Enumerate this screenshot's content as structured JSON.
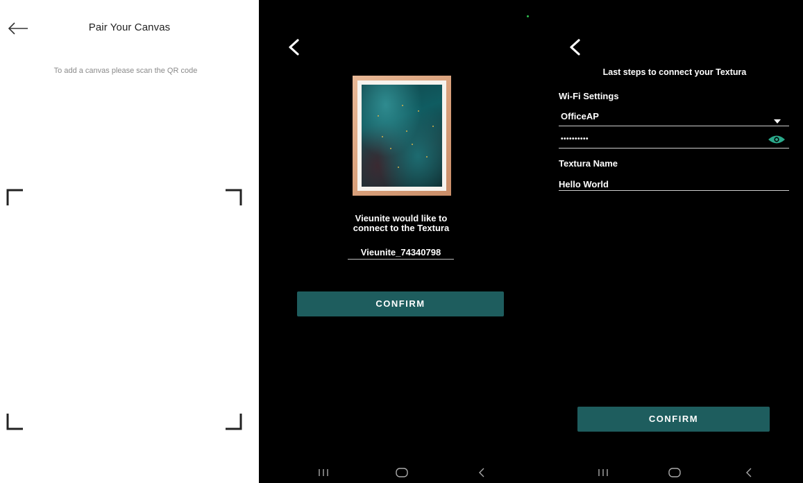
{
  "screen1": {
    "title": "Pair Your Canvas",
    "hint": "To add a canvas please scan the QR code"
  },
  "screen2": {
    "message_line1": "Vieunite would like to",
    "message_line2": "connect to the Textura",
    "network_name": "Vieunite_74340798",
    "confirm_label": "CONFIRM"
  },
  "screen3": {
    "heading": "Last steps to connect your Textura",
    "wifi_label": "Wi-Fi Settings",
    "wifi_selected": "OfficeAP",
    "password_masked": "••••••••••",
    "name_label": "Textura Name",
    "name_value": "Hello World",
    "confirm_label": "CONFIRM"
  },
  "colors": {
    "accent": "#1e5d5e",
    "eye_icon": "#2aa88a",
    "background_dark": "#000000",
    "background_light": "#ffffff"
  },
  "icons": [
    "back-arrow-icon",
    "chevron-left-icon",
    "dropdown-caret-icon",
    "eye-icon",
    "recents-icon",
    "home-icon",
    "back-nav-icon"
  ]
}
